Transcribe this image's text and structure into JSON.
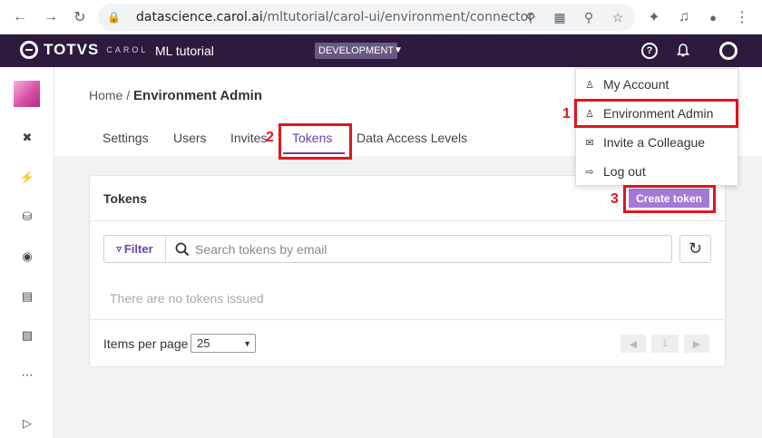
{
  "browser": {
    "url_host": "datascience.carol.ai",
    "url_path": "/mltutorial/carol-ui/environment/connector-to..."
  },
  "header": {
    "brand": "TOTVS",
    "brand_sub": "CAROL",
    "app_name": "ML tutorial",
    "env_badge": "DEVELOPMENT",
    "help_symbol": "?"
  },
  "breadcrumb": {
    "home": "Home",
    "separator": " / ",
    "current": "Environment Admin"
  },
  "tabs": [
    "Settings",
    "Users",
    "Invites",
    "Tokens",
    "Data Access Levels"
  ],
  "active_tab": "Tokens",
  "card": {
    "title": "Tokens",
    "create_button": "Create token",
    "filter_label": "Filter",
    "search_placeholder": "Search tokens by email",
    "empty_message": "There are no tokens issued",
    "items_per_page_label": "Items per page",
    "items_per_page_value": "25",
    "current_page": "1"
  },
  "user_menu": {
    "items": [
      "My Account",
      "Environment Admin",
      "Invite a Colleague",
      "Log out"
    ]
  },
  "annotations": [
    "1",
    "2",
    "3"
  ],
  "colors": {
    "header_bg": "#2d1a3d",
    "accent": "#6a3fb0",
    "highlight": "#e0141e",
    "button": "#a57ad6"
  }
}
